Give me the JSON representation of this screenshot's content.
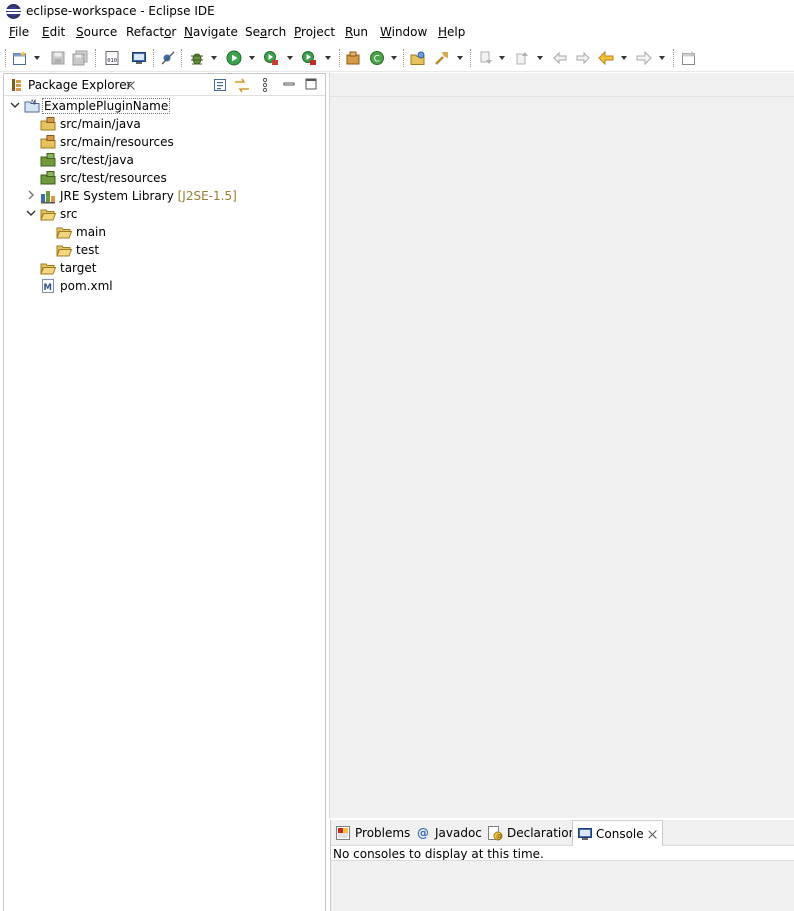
{
  "window": {
    "title": "eclipse-workspace - Eclipse IDE"
  },
  "menubar": {
    "items": [
      {
        "label": "File",
        "mnemonic_index": 0
      },
      {
        "label": "Edit",
        "mnemonic_index": 0
      },
      {
        "label": "Source",
        "mnemonic_index": 0
      },
      {
        "label": "Refactor",
        "mnemonic_index": 6
      },
      {
        "label": "Navigate",
        "mnemonic_index": 0
      },
      {
        "label": "Search",
        "mnemonic_index": 2
      },
      {
        "label": "Project",
        "mnemonic_index": 0
      },
      {
        "label": "Run",
        "mnemonic_index": 0
      },
      {
        "label": "Window",
        "mnemonic_index": 0
      },
      {
        "label": "Help",
        "mnemonic_index": 0
      }
    ]
  },
  "toolbar": {
    "icons": [
      "new-icon",
      "save-icon",
      "save-all-icon",
      "binary-icon",
      "terminal-icon",
      "skip-breakpoints-icon",
      "debug-icon",
      "run-icon",
      "coverage-icon",
      "external-tools-icon",
      "new-java-package-icon",
      "new-java-class-icon",
      "open-type-icon",
      "search-icon",
      "next-annotation-icon",
      "previous-annotation-icon",
      "last-edit-location-icon",
      "back-icon",
      "forward-icon",
      "open-perspective-icon"
    ]
  },
  "explorer": {
    "tab_label": "Package Explorer",
    "tree": [
      {
        "label": "ExamplePluginName",
        "decoration": "",
        "icon": "project-icon",
        "expanded": true,
        "selected": true,
        "depth": 0
      },
      {
        "label": "src/main/java",
        "decoration": "",
        "icon": "source-folder-icon",
        "depth": 1
      },
      {
        "label": "src/main/resources",
        "decoration": "",
        "icon": "source-folder-icon",
        "depth": 1
      },
      {
        "label": "src/test/java",
        "decoration": "",
        "icon": "test-source-folder-icon",
        "depth": 1
      },
      {
        "label": "src/test/resources",
        "decoration": "",
        "icon": "test-source-folder-icon",
        "depth": 1
      },
      {
        "label": "JRE System Library",
        "decoration": "[J2SE-1.5]",
        "icon": "library-icon",
        "expanded": false,
        "depth": 1
      },
      {
        "label": "src",
        "decoration": "",
        "icon": "folder-icon",
        "expanded": true,
        "depth": 1
      },
      {
        "label": "main",
        "decoration": "",
        "icon": "folder-icon",
        "depth": 2
      },
      {
        "label": "test",
        "decoration": "",
        "icon": "folder-icon",
        "depth": 2
      },
      {
        "label": "target",
        "decoration": "",
        "icon": "folder-icon",
        "depth": 1
      },
      {
        "label": "pom.xml",
        "decoration": "",
        "icon": "maven-file-icon",
        "depth": 1
      }
    ]
  },
  "bottom_panel": {
    "tabs": [
      {
        "label": "Problems",
        "icon": "problems-icon"
      },
      {
        "label": "Javadoc",
        "icon": "javadoc-icon"
      },
      {
        "label": "Declaration",
        "icon": "declaration-icon"
      },
      {
        "label": "Console",
        "icon": "console-icon",
        "active": true
      }
    ],
    "console_message": "No consoles to display at this time."
  },
  "colors": {
    "accent": "#2c2f6e",
    "decoration": "#957f33",
    "editor_bg": "#f0f0f0",
    "selection_outline": "#7a7a7a"
  }
}
